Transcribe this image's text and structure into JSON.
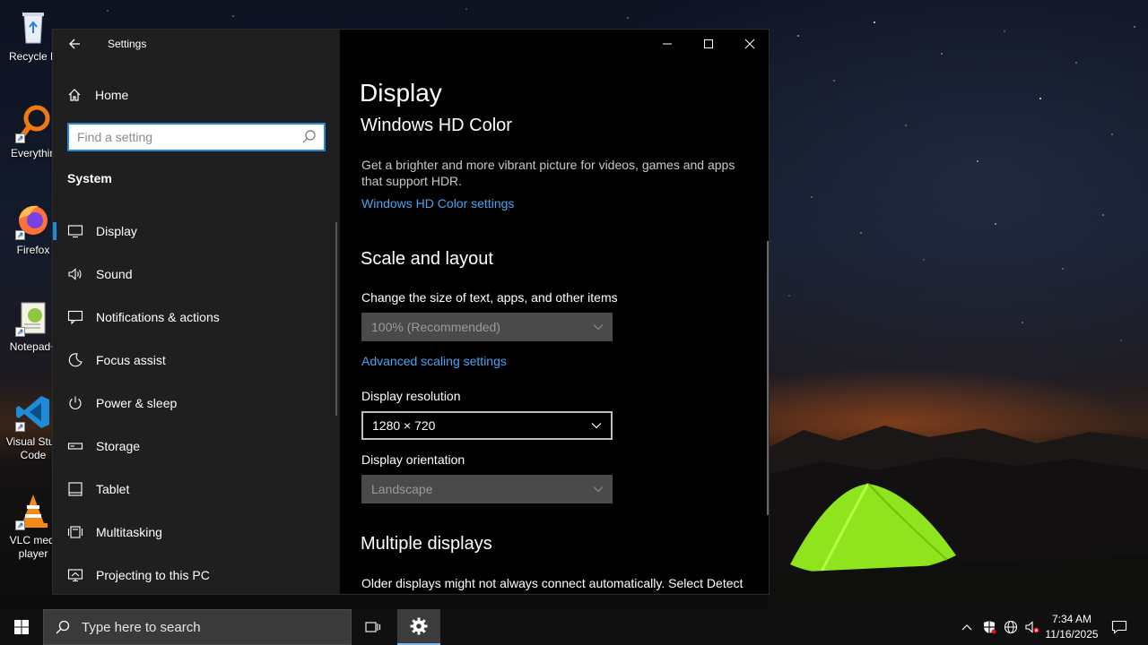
{
  "desktop": {
    "icons": [
      {
        "label": "Recycle B",
        "icon": "recycle-bin-icon"
      },
      {
        "label": "Everythin",
        "icon": "everything-search-icon"
      },
      {
        "label": "Firefox",
        "icon": "firefox-icon"
      },
      {
        "label": "Notepad+",
        "icon": "notepad-plus-plus-icon"
      },
      {
        "label_line1": "Visual Stud",
        "label_line2": "Code",
        "icon": "vscode-icon"
      },
      {
        "label_line1": "VLC medi",
        "label_line2": "player",
        "icon": "vlc-icon"
      }
    ]
  },
  "window": {
    "title": "Settings",
    "sidebar": {
      "home_label": "Home",
      "search_placeholder": "Find a setting",
      "section": "System",
      "items": [
        {
          "label": "Display",
          "icon": "display-icon",
          "selected": true
        },
        {
          "label": "Sound",
          "icon": "sound-icon"
        },
        {
          "label": "Notifications & actions",
          "icon": "notifications-icon"
        },
        {
          "label": "Focus assist",
          "icon": "focus-assist-icon"
        },
        {
          "label": "Power & sleep",
          "icon": "power-icon"
        },
        {
          "label": "Storage",
          "icon": "storage-icon"
        },
        {
          "label": "Tablet",
          "icon": "tablet-icon"
        },
        {
          "label": "Multitasking",
          "icon": "multitasking-icon"
        },
        {
          "label": "Projecting to this PC",
          "icon": "projecting-icon"
        }
      ]
    },
    "content": {
      "page_title": "Display",
      "hdr": {
        "heading": "Windows HD Color",
        "description": "Get a brighter and more vibrant picture for videos, games and apps that support HDR.",
        "link": "Windows HD Color settings"
      },
      "scale": {
        "heading": "Scale and layout",
        "size_label": "Change the size of text, apps, and other items",
        "size_value": "100% (Recommended)",
        "advanced_link": "Advanced scaling settings",
        "resolution_label": "Display resolution",
        "resolution_value": "1280 × 720",
        "orientation_label": "Display orientation",
        "orientation_value": "Landscape"
      },
      "multiple": {
        "heading": "Multiple displays",
        "description": "Older displays might not always connect automatically. Select Detect"
      }
    }
  },
  "taskbar": {
    "search_placeholder": "Type here to search",
    "time": "7:34 AM",
    "date": "11/16/2025"
  },
  "colors": {
    "accent": "#1f8ad6",
    "link": "#4aa3f0",
    "sidebar_bg": "#1f1f1f",
    "content_bg": "#000000",
    "taskbar_bg": "#101010"
  }
}
